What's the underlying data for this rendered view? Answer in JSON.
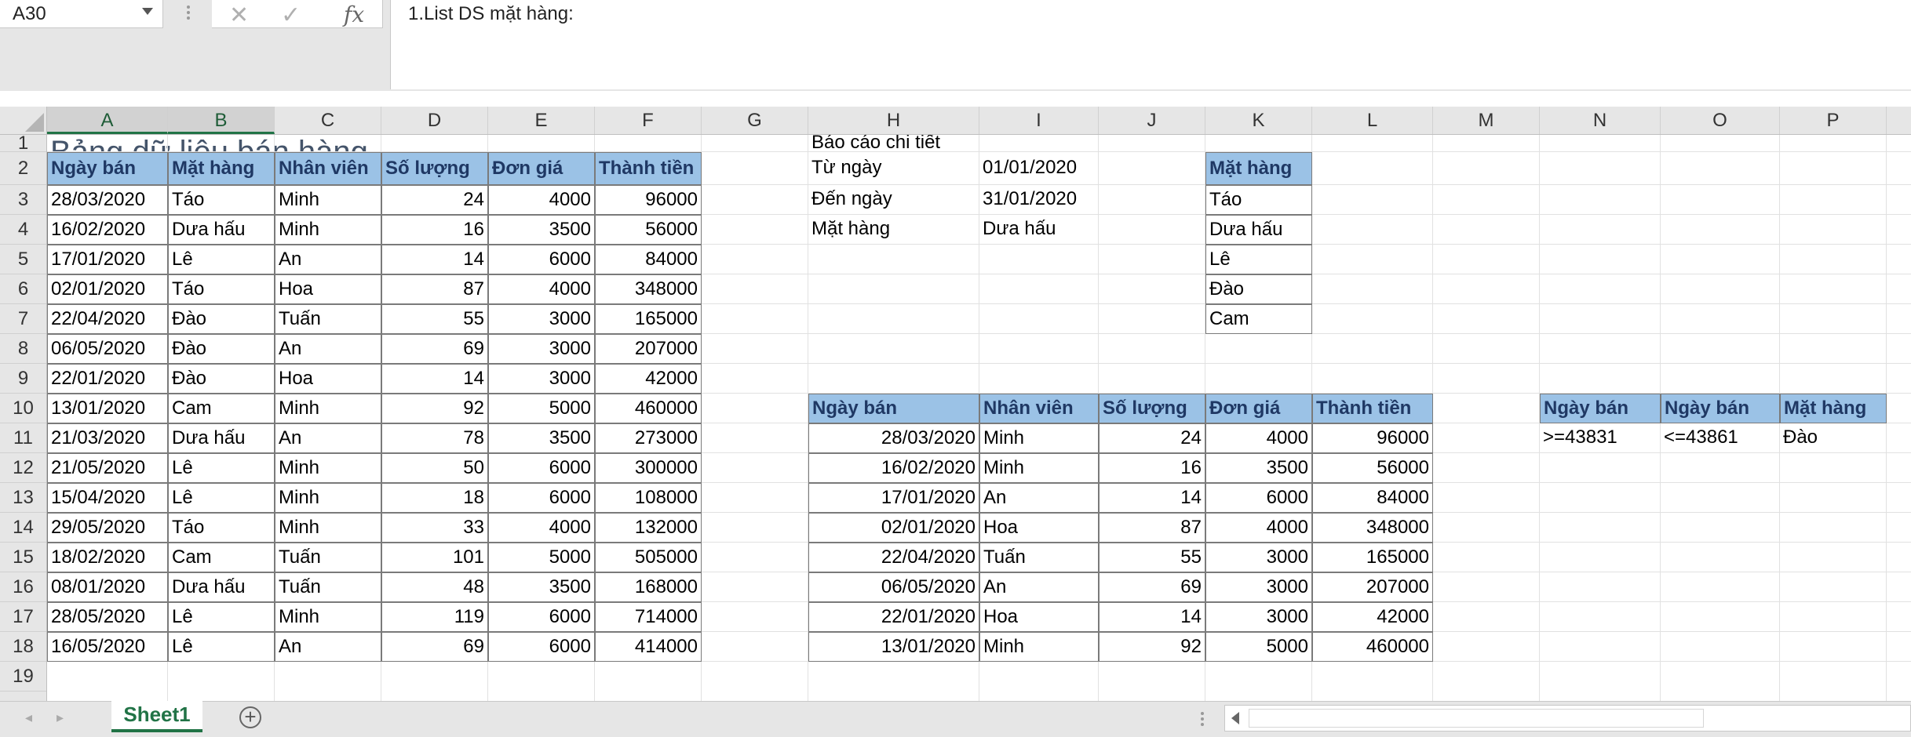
{
  "formula_bar": {
    "name_box": "A30",
    "cancel_icon": "close-icon",
    "enter_icon": "check-icon",
    "fx_label": "fx",
    "content": "1.List DS mặt hàng:"
  },
  "columns": [
    "A",
    "B",
    "C",
    "D",
    "E",
    "F",
    "G",
    "H",
    "I",
    "J",
    "K",
    "L",
    "M",
    "N",
    "O",
    "P"
  ],
  "rows": [
    "1",
    "2",
    "3",
    "4",
    "5",
    "6",
    "7",
    "8",
    "9",
    "10",
    "11",
    "12",
    "13",
    "14",
    "15",
    "16",
    "17",
    "18",
    "19"
  ],
  "sheet": {
    "title": "Bảng dữ liệu bán hàng",
    "headers": [
      "Ngày bán",
      "Mặt hàng",
      "Nhân viên",
      "Số lượng",
      "Đơn giá",
      "Thành tiền"
    ],
    "data": [
      [
        "28/03/2020",
        "Táo",
        "Minh",
        "24",
        "4000",
        "96000"
      ],
      [
        "16/02/2020",
        "Dưa hấu",
        "Minh",
        "16",
        "3500",
        "56000"
      ],
      [
        "17/01/2020",
        "Lê",
        "An",
        "14",
        "6000",
        "84000"
      ],
      [
        "02/01/2020",
        "Táo",
        "Hoa",
        "87",
        "4000",
        "348000"
      ],
      [
        "22/04/2020",
        "Đào",
        "Tuấn",
        "55",
        "3000",
        "165000"
      ],
      [
        "06/05/2020",
        "Đào",
        "An",
        "69",
        "3000",
        "207000"
      ],
      [
        "22/01/2020",
        "Đào",
        "Hoa",
        "14",
        "3000",
        "42000"
      ],
      [
        "13/01/2020",
        "Cam",
        "Minh",
        "92",
        "5000",
        "460000"
      ],
      [
        "21/03/2020",
        "Dưa hấu",
        "An",
        "78",
        "3500",
        "273000"
      ],
      [
        "21/05/2020",
        "Lê",
        "Minh",
        "50",
        "6000",
        "300000"
      ],
      [
        "15/04/2020",
        "Lê",
        "Minh",
        "18",
        "6000",
        "108000"
      ],
      [
        "29/05/2020",
        "Táo",
        "Minh",
        "33",
        "4000",
        "132000"
      ],
      [
        "18/02/2020",
        "Cam",
        "Tuấn",
        "101",
        "5000",
        "505000"
      ],
      [
        "08/01/2020",
        "Dưa hấu",
        "Tuấn",
        "48",
        "3500",
        "168000"
      ],
      [
        "28/05/2020",
        "Lê",
        "Minh",
        "119",
        "6000",
        "714000"
      ],
      [
        "16/05/2020",
        "Lê",
        "An",
        "69",
        "6000",
        "414000"
      ]
    ]
  },
  "report": {
    "title": "Báo cáo chi tiết",
    "from_label": "Từ ngày",
    "from_value": "01/01/2020",
    "to_label": "Đến ngày",
    "to_value": "31/01/2020",
    "item_label": "Mặt hàng",
    "item_value": "Dưa hấu"
  },
  "item_list": {
    "header": "Mặt hàng",
    "items": [
      "Táo",
      "Dưa hấu",
      "Lê",
      "Đào",
      "Cam"
    ]
  },
  "result": {
    "headers": [
      "Ngày bán",
      "Nhân viên",
      "Số lượng",
      "Đơn giá",
      "Thành tiền"
    ],
    "data": [
      [
        "28/03/2020",
        "Minh",
        "24",
        "4000",
        "96000"
      ],
      [
        "16/02/2020",
        "Minh",
        "16",
        "3500",
        "56000"
      ],
      [
        "17/01/2020",
        "An",
        "14",
        "6000",
        "84000"
      ],
      [
        "02/01/2020",
        "Hoa",
        "87",
        "4000",
        "348000"
      ],
      [
        "22/04/2020",
        "Tuấn",
        "55",
        "3000",
        "165000"
      ],
      [
        "06/05/2020",
        "An",
        "69",
        "3000",
        "207000"
      ],
      [
        "22/01/2020",
        "Hoa",
        "14",
        "3000",
        "42000"
      ],
      [
        "13/01/2020",
        "Minh",
        "92",
        "5000",
        "460000"
      ]
    ]
  },
  "criteria": {
    "headers": [
      "Ngày bán",
      "Ngày bán",
      "Mặt hàng"
    ],
    "values": [
      ">=43831",
      "<=43861",
      "Đào"
    ]
  },
  "tabs": {
    "sheet1": "Sheet1",
    "add_icon": "plus-circle-icon"
  }
}
